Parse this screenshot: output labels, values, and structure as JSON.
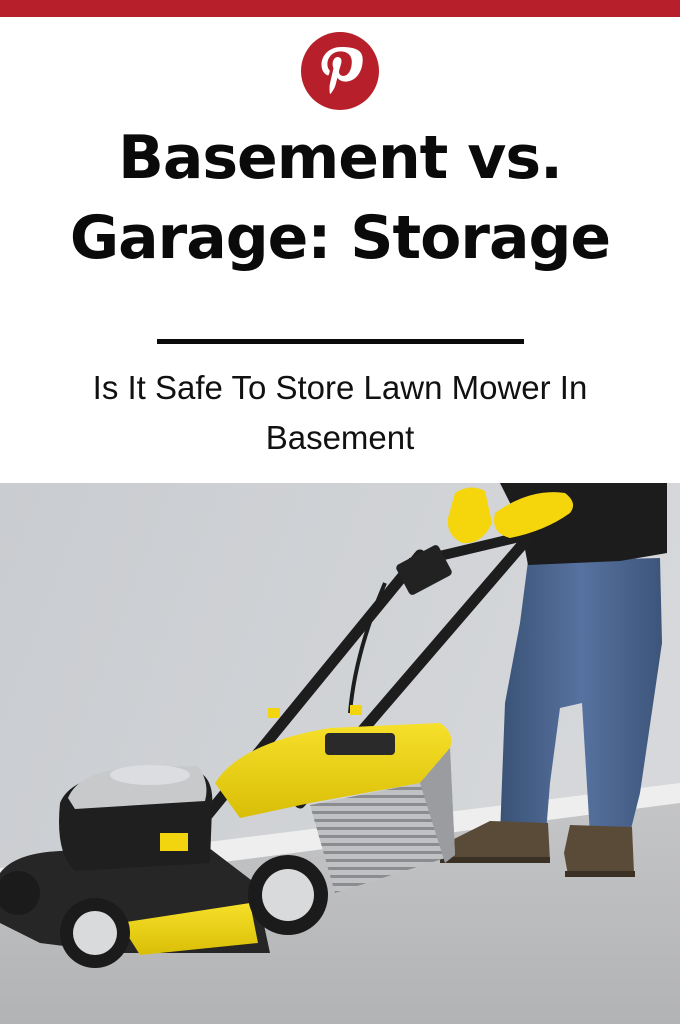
{
  "brand": {
    "logo_icon": "pinterest-logo-icon",
    "color": "#b7202b"
  },
  "headline": {
    "line1": "Basement vs.",
    "line2": "Garage: Storage"
  },
  "subtitle": "Is It Safe To Store Lawn Mower In Basement",
  "photo": {
    "subject": "lawn-mower-photo",
    "accent": "#f2d40f"
  }
}
